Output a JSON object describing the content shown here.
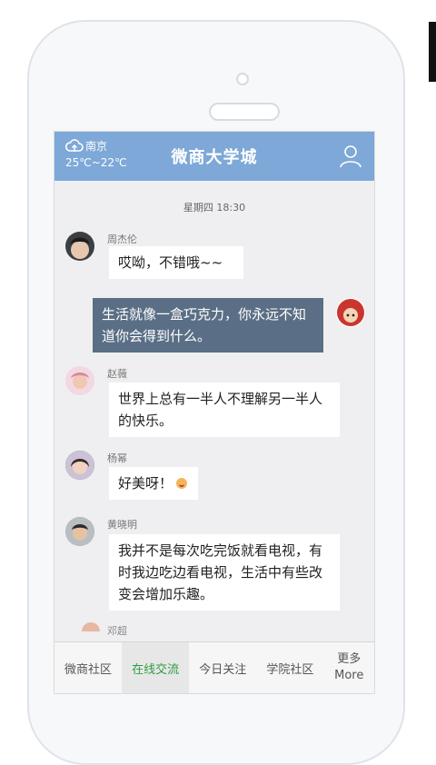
{
  "header": {
    "city": "南京",
    "temperature": "25℃~22℃",
    "title": "微商大学城",
    "icons": {
      "weather": "cloud-upload-icon",
      "profile": "user-icon"
    }
  },
  "chat": {
    "timestamp": "星期四 18:30",
    "messages": [
      {
        "name": "周杰伦",
        "text": "哎呦，不错哦~~"
      },
      {
        "name": "",
        "text": "生活就像一盒巧克力，你永远不知道你会得到什么。",
        "self": true
      },
      {
        "name": "赵薇",
        "text": "世界上总有一半人不理解另一半人的快乐。"
      },
      {
        "name": "杨幂",
        "text": "好美呀！"
      },
      {
        "name": "黄晓明",
        "text": "我并不是每次吃完饭就看电视，有时我边吃边看电视，生活中有些改变会增加乐趣。"
      }
    ],
    "partial_name": "邓超"
  },
  "tabs": [
    {
      "label": "微商社区"
    },
    {
      "label": "在线交流",
      "active": true
    },
    {
      "label": "今日关注"
    },
    {
      "label": "学院社区"
    },
    {
      "label": "更多",
      "sub": "More"
    }
  ],
  "colors": {
    "header": "#7ea8d7",
    "active_tab": "#2e9e3f",
    "self_bubble": "#5a6f86"
  }
}
